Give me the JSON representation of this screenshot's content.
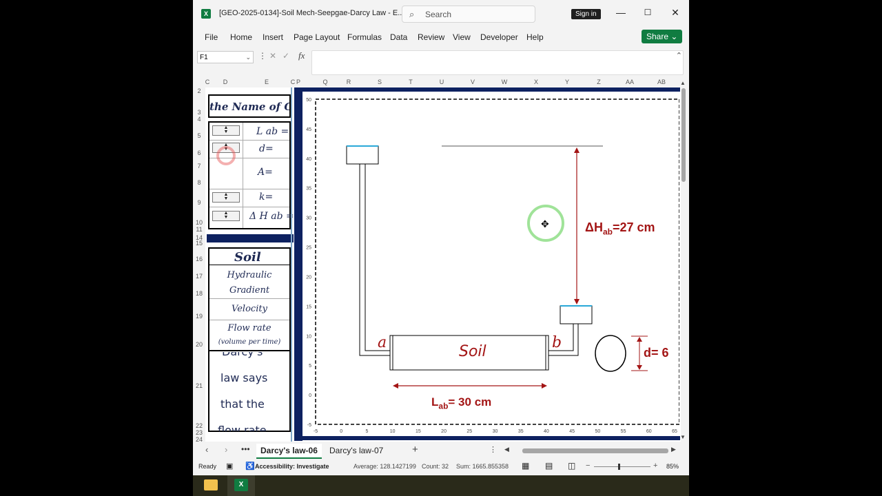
{
  "window": {
    "title": "[GEO-2025-0134]-Soil Mech-Seepgae-Darcy Law  -  E...",
    "search_placeholder": "Search",
    "signin": "Sign in"
  },
  "menu": [
    "File",
    "Home",
    "Insert",
    "Page Layout",
    "Formulas",
    "Data",
    "Review",
    "View",
    "Developer",
    "Help"
  ],
  "share_label": "Share",
  "formula_bar": {
    "name_box": "F1",
    "fx": "fx",
    "value": ""
  },
  "columns": [
    "C",
    "D",
    "E",
    "C",
    "P",
    "Q",
    "R",
    "S",
    "T",
    "U",
    "V",
    "W",
    "X",
    "Y",
    "Z",
    "AA",
    "AB"
  ],
  "rows": [
    "2",
    "3",
    "4",
    "5",
    "6",
    "7",
    "8",
    "9",
    "10",
    "11",
    "14",
    "15",
    "16",
    "17",
    "18",
    "19",
    "20",
    "21",
    "22",
    "23",
    "24"
  ],
  "left_panel": {
    "header": "the Name of Go",
    "params": [
      "L ab =",
      "d=",
      "A=",
      "k=",
      "Δ H ab ="
    ],
    "soil_title": "Soil",
    "hydraulic": "Hydraulic\nGradient",
    "velocity": "Velocity",
    "flow_rate": "Flow rate",
    "flow_rate_sub": "(volume per time)",
    "darcy_lines": [
      "Darcy's",
      "law says",
      "that the",
      "flow rate"
    ]
  },
  "chart": {
    "x_ticks": [
      "-5",
      "0",
      "5",
      "10",
      "15",
      "20",
      "25",
      "30",
      "35",
      "40",
      "45",
      "50",
      "55",
      "60",
      "65"
    ],
    "y_ticks": [
      "50",
      "45",
      "40",
      "35",
      "30",
      "25",
      "20",
      "15",
      "10",
      "5",
      "0",
      "-5"
    ],
    "label_a": "a",
    "label_b": "b",
    "soil": "Soil",
    "lab_label": "L",
    "lab_sub": "ab",
    "lab_value": "= 30 cm",
    "dh_label": "ΔH",
    "dh_sub": "ab",
    "dh_value": "=27 cm",
    "d_label": "d= 6",
    "accent_red": "#a31515",
    "water_blue": "#29a8d8"
  },
  "tabs": [
    "Darcy's law-06",
    "Darcy's law-07"
  ],
  "status": {
    "ready": "Ready",
    "accessibility": "Accessibility: Investigate",
    "average": "Average: 128.1427199",
    "count": "Count: 32",
    "sum": "Sum: 1665.855358",
    "zoom": "85%"
  }
}
